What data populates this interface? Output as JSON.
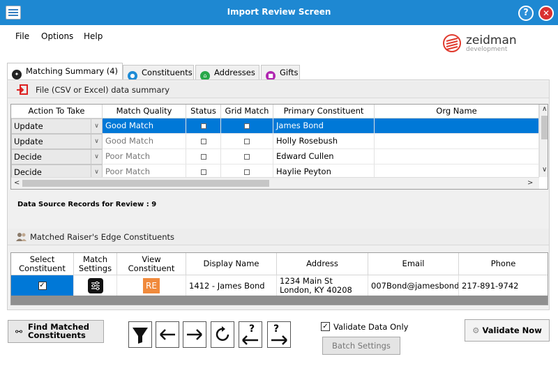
{
  "window": {
    "title": "Import Review Screen",
    "help_glyph": "?",
    "close_glyph": "✕"
  },
  "menu": {
    "items": [
      "File",
      "Options",
      "Help"
    ]
  },
  "logo": {
    "name": "zeidman",
    "sub": "development"
  },
  "tabs": [
    {
      "label": "Matching Summary (4)",
      "icon": "matching-summary-icon",
      "color": "#222222"
    },
    {
      "label": "Constituents",
      "icon": "constituents-icon",
      "color": "#1e8bd6"
    },
    {
      "label": "Addresses",
      "icon": "addresses-icon",
      "color": "#2aa84a"
    },
    {
      "label": "Gifts",
      "icon": "gifts-icon",
      "color": "#b026b0"
    }
  ],
  "file_summary": {
    "title": "File (CSV or Excel) data summary",
    "columns": [
      "Action To Take",
      "Match Quality",
      "Status",
      "Grid Match",
      "Primary Constituent",
      "Org Name"
    ],
    "rows": [
      {
        "action": "Update",
        "quality": "Good Match",
        "status_checked": false,
        "grid_checked": false,
        "primary": "James Bond",
        "org": "",
        "selected": true
      },
      {
        "action": "Update",
        "quality": "Good Match",
        "status_checked": false,
        "grid_checked": false,
        "primary": "Holly Rosebush",
        "org": "",
        "selected": false
      },
      {
        "action": "Decide",
        "quality": "Poor Match",
        "status_checked": false,
        "grid_checked": false,
        "primary": "Edward Cullen",
        "org": "",
        "selected": false
      },
      {
        "action": "Decide",
        "quality": "Poor Match",
        "status_checked": false,
        "grid_checked": false,
        "primary": "Haylie Peyton",
        "org": "",
        "selected": false
      }
    ]
  },
  "data_source_label": "Data Source Records for Review : 9",
  "matched": {
    "title": "Matched Raiser's Edge Constituents",
    "columns": {
      "select": [
        "Select",
        "Constituent"
      ],
      "match": [
        "Match",
        "Settings"
      ],
      "view": [
        "View",
        "Constituent"
      ],
      "display": "Display Name",
      "address": "Address",
      "email": "Email",
      "phone": "Phone"
    },
    "row": {
      "selected": true,
      "re_badge": "RE",
      "display_name": "1412 - James Bond",
      "address_line1": "1234 Main St",
      "address_line2": "London, KY  40208",
      "email": "007Bond@jamesbond.",
      "phone": "217-891-9742"
    }
  },
  "actions": {
    "find_matched": [
      "Find Matched",
      "Constituents"
    ],
    "validate_label": "Validate Data Only",
    "validate_checked": true,
    "batch_settings": "Batch Settings",
    "validate_now": "Validate Now",
    "help_glyph": "?"
  },
  "colors": {
    "titlebar": "#1e88d2",
    "selection": "#0078d7",
    "re_badge": "#f08a3c",
    "close": "#d93030"
  }
}
